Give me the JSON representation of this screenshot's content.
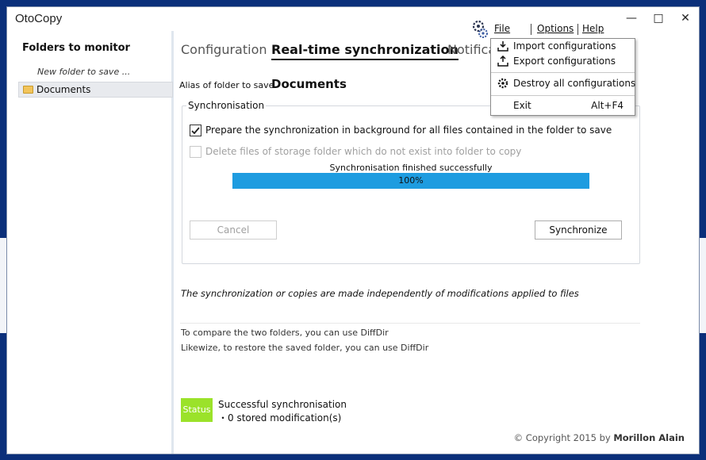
{
  "window": {
    "title": "OtoCopy",
    "minimize": "—",
    "maximize": "□",
    "close": "✕"
  },
  "menubar": {
    "file": "File",
    "options": "Options",
    "help": "Help"
  },
  "file_menu": {
    "import": "Import configurations",
    "export": "Export configurations",
    "destroy": "Destroy all configurations",
    "exit": "Exit",
    "exit_shortcut": "Alt+F4"
  },
  "sidebar": {
    "title": "Folders to monitor",
    "new_folder": "New folder to save ...",
    "items": [
      {
        "label": "Documents"
      }
    ]
  },
  "tabs": [
    {
      "label": "Configuration"
    },
    {
      "label": "Real-time synchronization"
    },
    {
      "label": "Notifica"
    }
  ],
  "main": {
    "alias_label": "Alias of folder to save",
    "alias_value": "Documents",
    "group_title": "Synchronisation",
    "check_prepare": "Prepare the synchronization in background for all files contained in the folder to save",
    "check_delete": "Delete files of storage folder which do not exist into folder to copy",
    "progress_caption": "Synchronisation finished successfully",
    "progress_percent": "100%",
    "progress_value": 100,
    "cancel_label": "Cancel",
    "synchronize_label": "Synchronize",
    "note": "The synchronization or copies are made independently of modifications applied to files",
    "info_compare": "To compare the two folders, you can use DiffDir",
    "info_restore": "Likewize, to restore the saved folder, you can use DiffDir"
  },
  "status": {
    "badge": "Status",
    "line1": "Successful synchronisation",
    "line2": "・0 stored modification(s)"
  },
  "footer": {
    "copyright_prefix": "© Copyright 2015 by",
    "author": "Morillon Alain"
  },
  "colors": {
    "progress": "#1e9ce0",
    "status_badge": "#9be22a",
    "desktop": "#0b2f7a"
  }
}
